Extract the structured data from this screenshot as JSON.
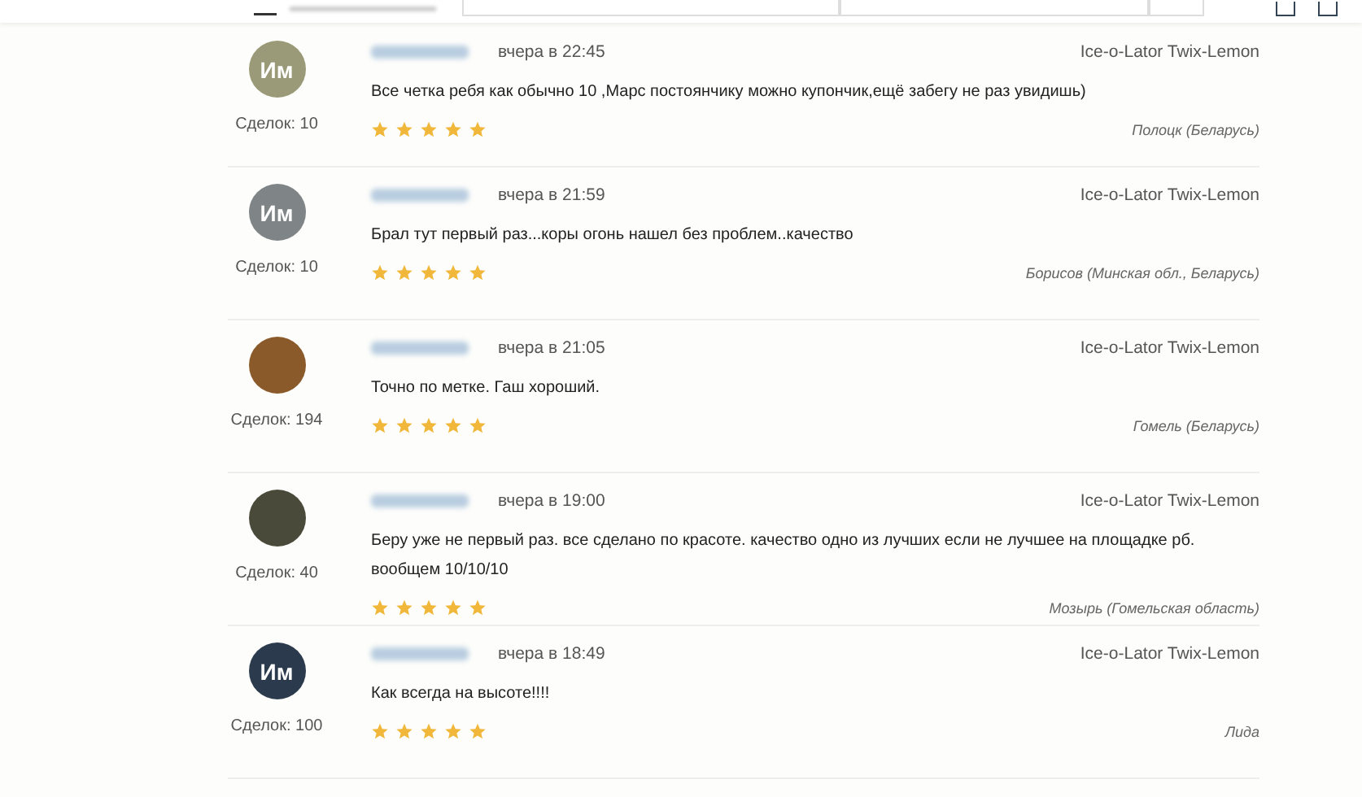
{
  "reviews": [
    {
      "avatar": {
        "kind": "initials",
        "text": "Им",
        "color": "#9a9a78"
      },
      "deals": "Сделок: 10",
      "time": "вчера в 22:45",
      "product": "Ice-o-Lator Twix-Lemon",
      "text": "Все четка ребя как обычно 10 ,Марс постоянчику можно купончик,ещё забегу не раз увидишь)",
      "stars": 5,
      "location": "Полоцк (Беларусь)"
    },
    {
      "avatar": {
        "kind": "initials",
        "text": "Им",
        "color": "#7f8486"
      },
      "deals": "Сделок: 10",
      "time": "вчера в 21:59",
      "product": "Ice-o-Lator Twix-Lemon",
      "text": "Брал тут первый раз...коры огонь нашел без проблем..качество",
      "stars": 5,
      "location": "Борисов (Минская обл., Беларусь)"
    },
    {
      "avatar": {
        "kind": "photo",
        "color": "#8a5a2a"
      },
      "deals": "Сделок: 194",
      "time": "вчера в 21:05",
      "product": "Ice-o-Lator Twix-Lemon",
      "text": "Точно по метке. Гаш хороший.",
      "stars": 5,
      "location": "Гомель (Беларусь)"
    },
    {
      "avatar": {
        "kind": "photo",
        "color": "#4a4a3a"
      },
      "deals": "Сделок: 40",
      "time": "вчера в 19:00",
      "product": "Ice-o-Lator Twix-Lemon",
      "text": "Беру уже не первый раз. все сделано по красоте. качество одно из лучших если не лучшее на площадке рб. вообщем 10/10/10",
      "stars": 5,
      "location": "Мозырь (Гомельская область)"
    },
    {
      "avatar": {
        "kind": "initials",
        "text": "Им",
        "color": "#2b3a4c"
      },
      "deals": "Сделок: 100",
      "time": "вчера в 18:49",
      "product": "Ice-o-Lator Twix-Lemon",
      "text": "Как всегда на высоте!!!!",
      "stars": 5,
      "location": "Лида"
    }
  ]
}
